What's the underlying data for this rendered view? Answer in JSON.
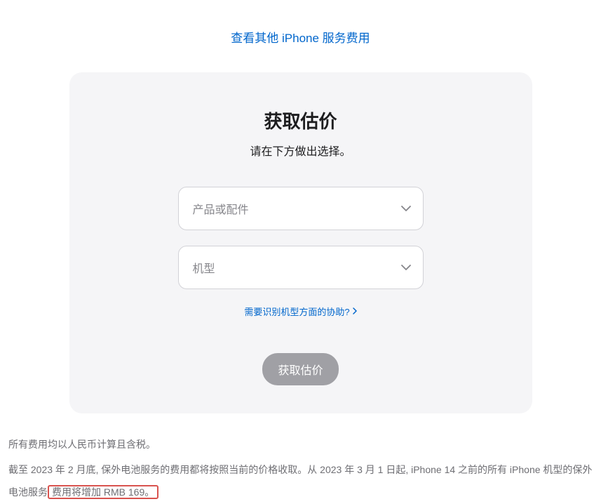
{
  "topLink": {
    "label": "查看其他 iPhone 服务费用"
  },
  "card": {
    "title": "获取估价",
    "subtitle": "请在下方做出选择。",
    "select1": {
      "placeholder": "产品或配件"
    },
    "select2": {
      "placeholder": "机型"
    },
    "helpLink": {
      "label": "需要识别机型方面的协助?"
    },
    "submitLabel": "获取估价"
  },
  "footnotes": {
    "line1": "所有费用均以人民币计算且含税。",
    "line2_part1": "截至 2023 年 2 月底, 保外电池服务的费用都将按照当前的价格收取。从 2023 年 3 月 1 日起, iPhone 14 之前的所有 iPhone 机型的保外电池服务",
    "line2_highlight": "费用将增加 RMB 169。"
  }
}
